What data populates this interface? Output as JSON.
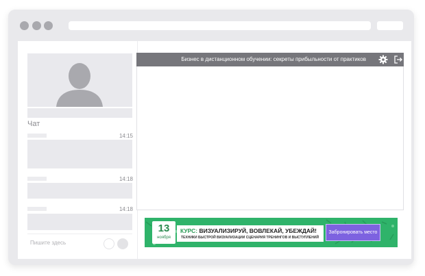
{
  "colors": {
    "frame": "#e9e9ec",
    "header": "#76767b",
    "banner_green": "#2fb36a",
    "button_purple": "#7d62e0",
    "accent_green": "#2a9a55"
  },
  "chat": {
    "label": "Чат",
    "messages": [
      {
        "time": "14:15"
      },
      {
        "time": "14:18"
      },
      {
        "time": "14:18"
      }
    ],
    "input_placeholder": "Пишите здесь"
  },
  "video": {
    "title": "Бизнес в дистанционном обучении: секреты прибыльности от практиков",
    "icons": [
      "gear-icon",
      "exit-icon"
    ]
  },
  "banner": {
    "day": "13",
    "month": "ноября",
    "course_prefix": "КУРС:",
    "course_title": " ВИЗУАЛИЗИРУЙ, ВОВЛЕКАЙ, УБЕЖДАЙ!",
    "course_subtitle": "ТЕХНИКИ БЫСТРОЙ ВИЗУАЛИЗАЦИИ СЦЕНАРИЯ ТРЕНИНГОВ И ВЫСТУПЛЕНИЙ",
    "button": "Забронировать место"
  }
}
